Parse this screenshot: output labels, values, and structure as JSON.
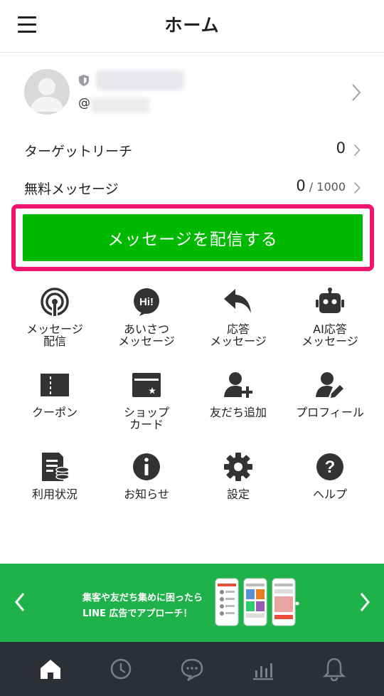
{
  "header": {
    "title": "ホーム"
  },
  "account": {
    "id_prefix": "@"
  },
  "stats": {
    "target_reach": {
      "label": "ターゲットリーチ",
      "value": "0"
    },
    "free_messages": {
      "label": "無料メッセージ",
      "value": "0",
      "quota": " / 1000"
    }
  },
  "cta": {
    "label": "メッセージを配信する"
  },
  "menu": {
    "message_delivery": "メッセージ\n配信",
    "greeting_message": "あいさつ\nメッセージ",
    "auto_reply": "応答\nメッセージ",
    "ai_reply": "AI応答\nメッセージ",
    "coupon": "クーポン",
    "shop_card": "ショップ\nカード",
    "add_friend": "友だち追加",
    "profile": "プロフィール",
    "usage": "利用状況",
    "notice": "お知らせ",
    "settings": "設定",
    "help": "ヘルプ"
  },
  "banner": {
    "line1": "集客や友だち集めに困ったら",
    "line2": "LINE 広告でアプローチ！"
  },
  "colors": {
    "brand_green": "#00b900",
    "highlight_pink": "#f0146e",
    "banner_green": "#20b24a",
    "nav_bg": "#2c3036",
    "icon_dark": "#333333"
  },
  "icons": {
    "nav": [
      "home-icon",
      "clock-icon",
      "chat-icon",
      "chart-icon",
      "bell-icon"
    ]
  }
}
